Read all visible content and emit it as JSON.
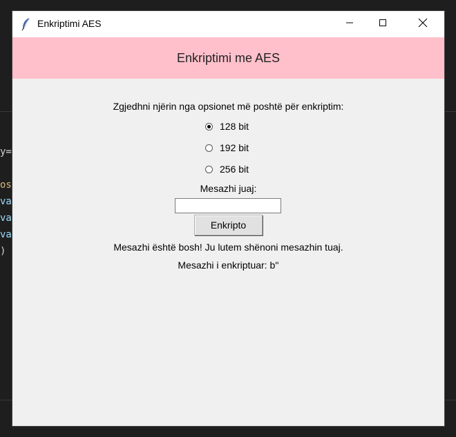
{
  "window": {
    "title": "Enkriptimi AES"
  },
  "header": {
    "title": "Enkriptimi me AES",
    "background": "#ffc0cb"
  },
  "form": {
    "prompt": "Zgjedhni njërin nga opsionet më poshtë për enkriptim:",
    "options": [
      {
        "label": "128 bit",
        "checked": true
      },
      {
        "label": "192 bit",
        "checked": false
      },
      {
        "label": "256 bit",
        "checked": false
      }
    ],
    "message_label": "Mesazhi juaj:",
    "message_value": "",
    "encrypt_label": "Enkripto",
    "status": "Mesazhi është bosh! Ju lutem shënoni mesazhin tuaj.",
    "result": "Mesazhi i enkriptuar: b''"
  },
  "background_code": {
    "lines": [
      "y='",
      "",
      "osi",
      "va",
      "va",
      "va",
      ")"
    ]
  },
  "icons": {
    "app": "feather-icon",
    "minimize": "minimize-icon",
    "maximize": "maximize-icon",
    "close": "close-icon"
  }
}
